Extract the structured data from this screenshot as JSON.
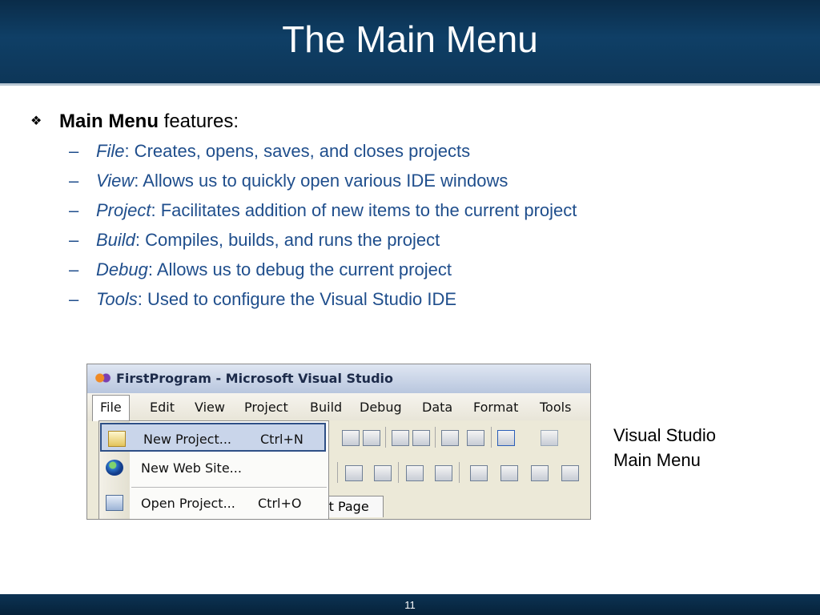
{
  "slide": {
    "title": "The Main Menu",
    "page_number": "11"
  },
  "bullets": {
    "main_bold": "Main Menu",
    "main_rest": " features:",
    "items": [
      {
        "term": "File",
        "desc": ": Creates, opens, saves, and closes projects"
      },
      {
        "term": "View",
        "desc": ": Allows us to quickly open various IDE windows"
      },
      {
        "term": "Project",
        "desc": ": Facilitates addition of new items to the current project"
      },
      {
        "term": "Build",
        "desc": ": Compiles, builds, and runs the project"
      },
      {
        "term": "Debug",
        "desc": ": Allows us to debug the current project"
      },
      {
        "term": "Tools",
        "desc": ": Used to configure the Visual Studio IDE"
      }
    ]
  },
  "screenshot": {
    "window_title": "FirstProgram - Microsoft Visual Studio",
    "menu_items": [
      "File",
      "Edit",
      "View",
      "Project",
      "Build",
      "Debug",
      "Data",
      "Format",
      "Tools"
    ],
    "dropdown": [
      {
        "label": "New Project...",
        "shortcut": "Ctrl+N",
        "icon": "new-project-icon"
      },
      {
        "label": "New Web Site...",
        "shortcut": "",
        "icon": "globe-icon"
      },
      {
        "label": "Open Project...",
        "shortcut": "Ctrl+O",
        "icon": "open-project-icon"
      }
    ],
    "tab_label": "rt Page"
  },
  "caption": {
    "line1": "Visual Studio",
    "line2": "Main Menu"
  }
}
